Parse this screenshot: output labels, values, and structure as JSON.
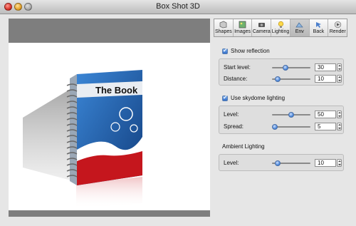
{
  "window": {
    "title": "Box Shot 3D"
  },
  "toolbar": {
    "items": [
      {
        "label": "Shapes",
        "icon": "shapes-icon"
      },
      {
        "label": "Images",
        "icon": "images-icon"
      },
      {
        "label": "Camera",
        "icon": "camera-icon"
      },
      {
        "label": "Lighting",
        "icon": "lightbulb-icon"
      },
      {
        "label": "Env",
        "icon": "environment-icon",
        "active": true
      },
      {
        "label": "Back",
        "icon": "back-icon"
      },
      {
        "label": "Render",
        "icon": "render-icon"
      }
    ]
  },
  "preview": {
    "book_title": "The Book"
  },
  "reflection": {
    "checkbox_label": "Show reflection",
    "checked": true,
    "start_level": {
      "label": "Start level:",
      "value": "30",
      "slider_fraction": 0.35
    },
    "distance": {
      "label": "Distance:",
      "value": "10",
      "slider_fraction": 0.14
    }
  },
  "skydome": {
    "checkbox_label": "Use skydome lighting",
    "checked": true,
    "level": {
      "label": "Level:",
      "value": "50",
      "slider_fraction": 0.5
    },
    "spread": {
      "label": "Spread:",
      "value": "5",
      "slider_fraction": 0.07
    }
  },
  "ambient": {
    "title": "Ambient Lighting",
    "level": {
      "label": "Level:",
      "value": "10",
      "slider_fraction": 0.14
    }
  },
  "colors": {
    "book_blue": "#1f5fa8",
    "book_red": "#c5161d",
    "accent_blue": "#3f7fd6"
  }
}
